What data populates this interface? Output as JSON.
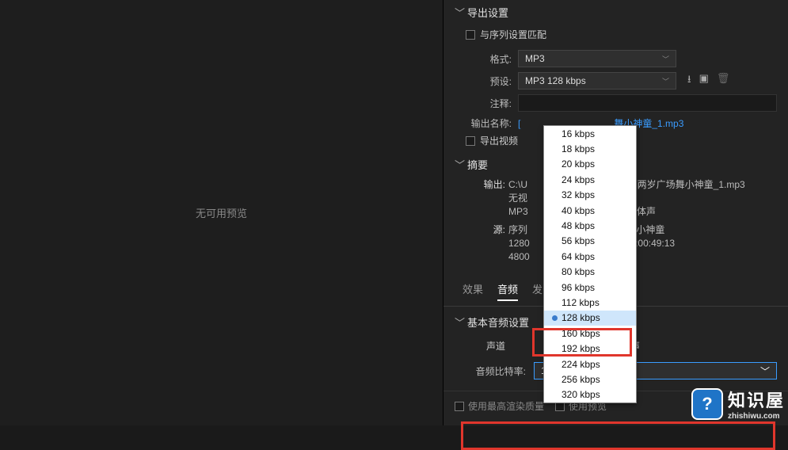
{
  "left": {
    "no_preview": "无可用预览"
  },
  "export": {
    "title": "导出设置",
    "match_sequence": "与序列设置匹配",
    "format_label": "格式:",
    "format_value": "MP3",
    "preset_label": "预设:",
    "preset_value": "MP3 128 kbps",
    "comment_label": "注释:",
    "output_name_label": "输出名称:",
    "output_name_value": "舞小神童_1.mp3",
    "export_video": "导出视频"
  },
  "summary": {
    "title": "摘要",
    "output_label": "输出:",
    "output_path": "C:\\U",
    "output_tail": "人]两岁广场舞小神童_1.mp3",
    "no_video": "无视",
    "codec": "MP3",
    "channels": "立体声",
    "source_label": "源:",
    "source_name": "序列",
    "source_tail": "场舞小神童",
    "res": "1280",
    "tc": ", 00:00:49:13",
    "fps": "4800"
  },
  "tabs": {
    "effects": "效果",
    "audio": "音频",
    "publish": "发"
  },
  "audio": {
    "title": "基本音频设置",
    "channel_label": "声道",
    "stereo": "立体声",
    "bitrate_label": "音频比特率:",
    "bitrate_value": "128 kbps"
  },
  "bottom": {
    "max_quality": "使用最高渲染质量",
    "use_preview": "使用预览"
  },
  "dropdown": {
    "options": [
      "16 kbps",
      "18 kbps",
      "20 kbps",
      "24 kbps",
      "32 kbps",
      "40 kbps",
      "48 kbps",
      "56 kbps",
      "64 kbps",
      "80 kbps",
      "96 kbps",
      "112 kbps",
      "128 kbps",
      "160 kbps",
      "192 kbps",
      "224 kbps",
      "256 kbps",
      "320 kbps"
    ],
    "selected": "128 kbps"
  },
  "watermark": {
    "title": "知识屋",
    "url": "zhishiwu.com",
    "glyph": "?"
  }
}
